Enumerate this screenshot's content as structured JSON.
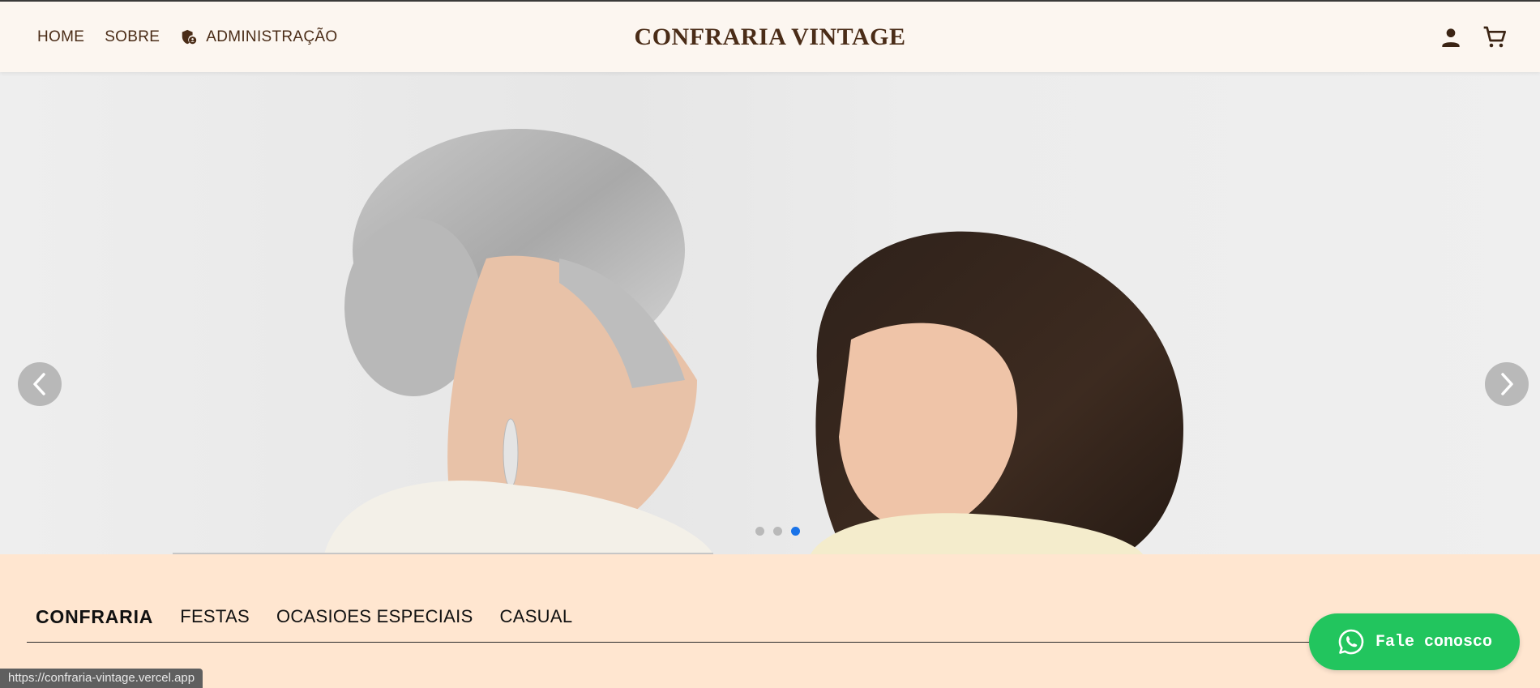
{
  "header": {
    "nav": [
      {
        "label": "HOME"
      },
      {
        "label": "SOBRE"
      },
      {
        "label": "ADMINISTRAÇÃO",
        "icon": "admin-shield-icon"
      }
    ],
    "brand": "CONFRARIA VINTAGE",
    "icons": [
      "user-icon",
      "cart-icon"
    ]
  },
  "hero": {
    "slides_count": 3,
    "active_slide": 3,
    "prev_icon": "chevron-left-icon",
    "next_icon": "chevron-right-icon"
  },
  "tabs": [
    {
      "label": "CONFRARIA",
      "active": true
    },
    {
      "label": "FESTAS",
      "active": false
    },
    {
      "label": "OCASIOES ESPECIAIS",
      "active": false
    },
    {
      "label": "CASUAL",
      "active": false
    }
  ],
  "whatsapp": {
    "label": "Fale conosco",
    "icon": "whatsapp-icon"
  },
  "status_url": "https://confraria-vintage.vercel.app",
  "colors": {
    "header_bg": "#fcf6f0",
    "brand_text": "#4a2c17",
    "page_bg": "#ffe6d0",
    "whatsapp_green": "#22c55e",
    "dot_active": "#1a73e8"
  }
}
